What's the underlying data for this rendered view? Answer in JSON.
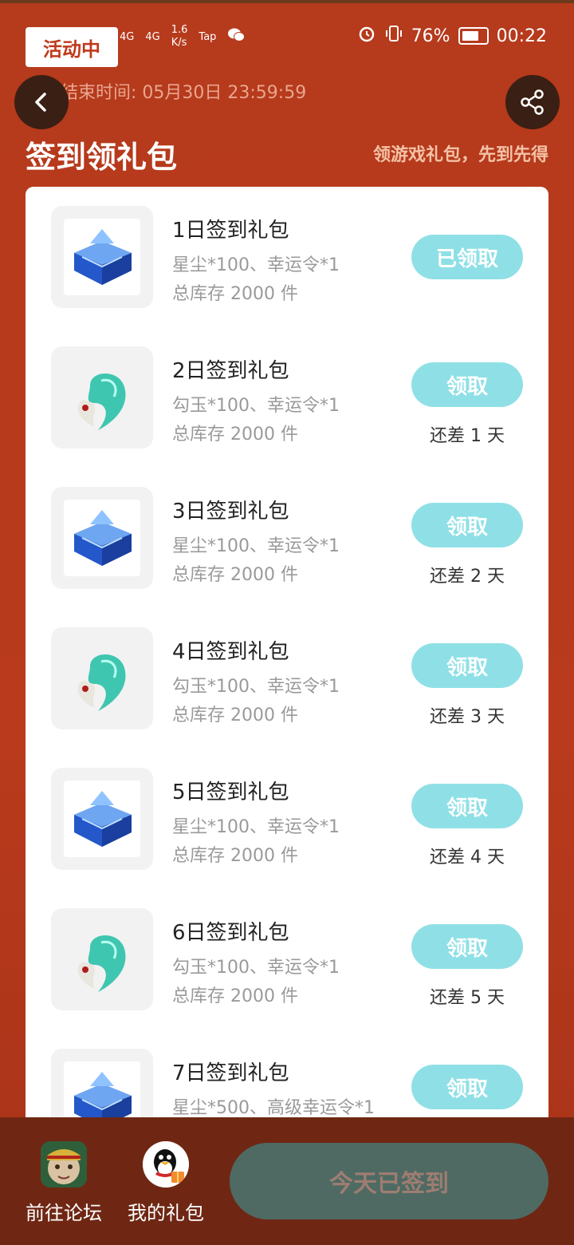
{
  "status_bar": {
    "signal_1": "4G",
    "signal_2": "4G",
    "speed_value": "1.6",
    "speed_unit": "K/s",
    "tap": "Tap",
    "battery_pct": "76%",
    "time": "00:22"
  },
  "header": {
    "badge": "活动中",
    "end_time": "活动结束时间: 05月30日 23:59:59",
    "title": "签到领礼包",
    "subtitle": "领游戏礼包，先到先得"
  },
  "gifts": [
    {
      "name": "1日签到礼包",
      "desc": "星尘*100、幸运令*1",
      "stock": "总库存 2000 件",
      "button": "已领取",
      "remain": "",
      "icon": "crystal-chest-icon"
    },
    {
      "name": "2日签到礼包",
      "desc": "勾玉*100、幸运令*1",
      "stock": "总库存 2000 件",
      "button": "领取",
      "remain": "还差 1 天",
      "icon": "magatama-icon"
    },
    {
      "name": "3日签到礼包",
      "desc": "星尘*100、幸运令*1",
      "stock": "总库存 2000 件",
      "button": "领取",
      "remain": "还差 2 天",
      "icon": "crystal-chest-icon"
    },
    {
      "name": "4日签到礼包",
      "desc": "勾玉*100、幸运令*1",
      "stock": "总库存 2000 件",
      "button": "领取",
      "remain": "还差 3 天",
      "icon": "magatama-icon"
    },
    {
      "name": "5日签到礼包",
      "desc": "星尘*100、幸运令*1",
      "stock": "总库存 2000 件",
      "button": "领取",
      "remain": "还差 4 天",
      "icon": "crystal-chest-icon"
    },
    {
      "name": "6日签到礼包",
      "desc": "勾玉*100、幸运令*1",
      "stock": "总库存 2000 件",
      "button": "领取",
      "remain": "还差 5 天",
      "icon": "magatama-icon"
    },
    {
      "name": "7日签到礼包",
      "desc": "星尘*500、高级幸运令*1",
      "stock": "",
      "button": "领取",
      "remain": "",
      "icon": "crystal-chest-icon"
    }
  ],
  "bottom": {
    "forum": "前往论坛",
    "my_gifts": "我的礼包",
    "signed_today": "今天已签到"
  },
  "colors": {
    "background": "#b93a1d",
    "button": "#8fe0e6",
    "sign_button": "#4e6a63",
    "bottom_bar": "#6f2714"
  }
}
